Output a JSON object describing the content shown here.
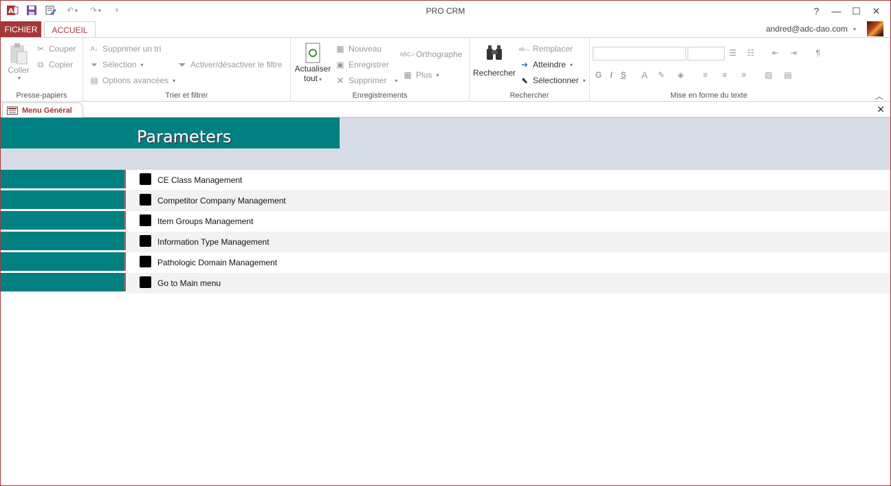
{
  "app": {
    "title": "PRO CRM",
    "account": "andred@adc-dao.com"
  },
  "window_controls": {
    "help": "?",
    "minimize": "—",
    "restore": "☐",
    "close": "✕"
  },
  "tabs": {
    "file": "FICHIER",
    "home": "ACCUEIL"
  },
  "ribbon": {
    "clipboard": {
      "label": "Presse-papiers",
      "paste": "Coller",
      "cut": "Couper",
      "copy": "Copier"
    },
    "sort_filter": {
      "label": "Trier et filtrer",
      "remove_sort": "Supprimer un tri",
      "selection": "Sélection",
      "advanced": "Options avancées",
      "toggle_filter": "Activer/désactiver le filtre"
    },
    "records": {
      "label": "Enregistrements",
      "refresh_line1": "Actualiser",
      "refresh_line2": "tout",
      "new": "Nouveau",
      "save": "Enregistrer",
      "delete": "Supprimer",
      "spelling": "Orthographe",
      "more": "Plus"
    },
    "find": {
      "label": "Rechercher",
      "find": "Rechercher",
      "replace": "Remplacer",
      "goto": "Atteindre",
      "select": "Sélectionner"
    },
    "text_format": {
      "label": "Mise en forme du texte",
      "bold": "G",
      "italic": "I",
      "underline": "S",
      "font_color": "A"
    }
  },
  "document_tab": {
    "label": "Menu Général",
    "close": "✕"
  },
  "form": {
    "title": "Parameters",
    "items": [
      {
        "label": "CE Class Management"
      },
      {
        "label": "Competitor Company Management"
      },
      {
        "label": "Item Groups Management"
      },
      {
        "label": "Information Type Management"
      },
      {
        "label": "Pathologic Domain Management"
      },
      {
        "label": "Go to Main menu"
      }
    ]
  },
  "colors": {
    "accent": "#a4373a",
    "teal": "#008080",
    "header_bg": "#d6dbe5"
  }
}
